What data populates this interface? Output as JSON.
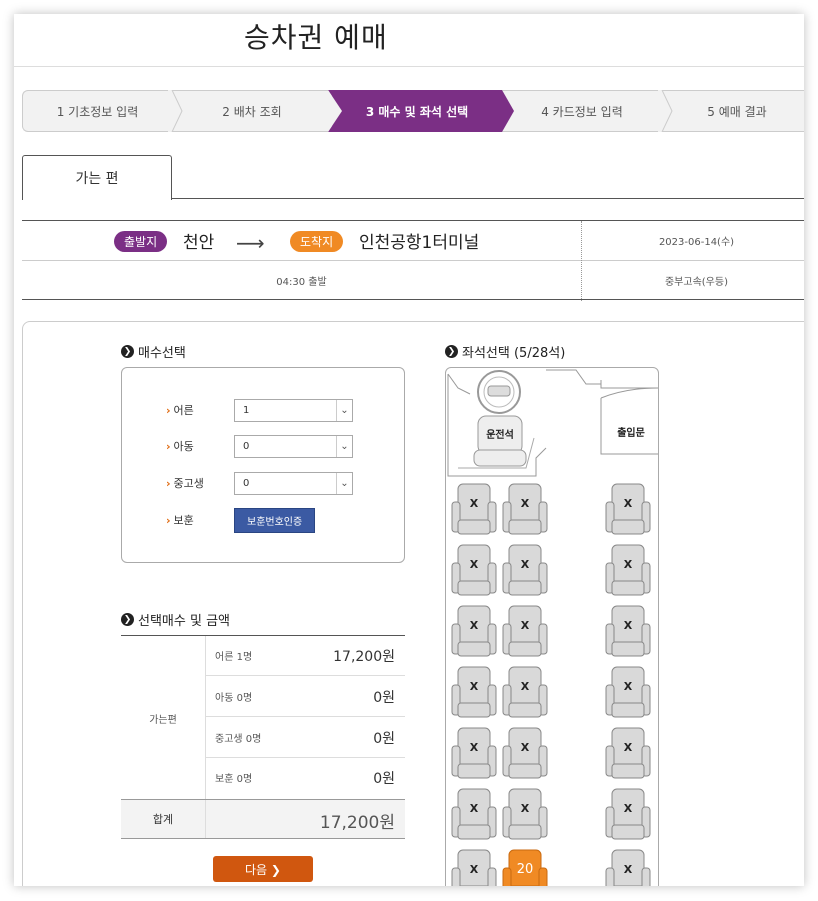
{
  "page": {
    "title": "승차권 예매"
  },
  "steps": [
    {
      "label": "1 기초정보 입력",
      "active": false
    },
    {
      "label": "2 배차 조회",
      "active": false
    },
    {
      "label": "3 매수 및 좌석 선택",
      "active": true
    },
    {
      "label": "4 카드정보 입력",
      "active": false
    },
    {
      "label": "5 예매 결과",
      "active": false
    }
  ],
  "tab": {
    "label": "가는 편"
  },
  "route": {
    "departure_badge": "출발지",
    "departure_city": "천안",
    "arrow": "⟶",
    "arrival_badge": "도착지",
    "arrival_city": "인천공항1터미널",
    "date": "2023-06-14(수)",
    "time": "04:30 출발",
    "company": "중부고속(우등)"
  },
  "quantity": {
    "title": "매수선택",
    "rows": [
      {
        "label": "어른",
        "value": "1"
      },
      {
        "label": "아동",
        "value": "0"
      },
      {
        "label": "중고생",
        "value": "0"
      }
    ],
    "veteran_label": "보훈",
    "veteran_button": "보훈번호인증"
  },
  "summary": {
    "title": "선택매수 및 금액",
    "side_label": "가는편",
    "rows": [
      {
        "label": "어른 1명",
        "value": "17,200원"
      },
      {
        "label": "아동 0명",
        "value": "0원"
      },
      {
        "label": "중고생 0명",
        "value": "0원"
      },
      {
        "label": "보훈 0명",
        "value": "0원"
      }
    ],
    "total_label": "합계",
    "total_value": "17,200원"
  },
  "next_button": "다음 ❯",
  "seats": {
    "title": "좌석선택 (5/28석)",
    "driver_label": "운전석",
    "door_label": "출입문",
    "taken_mark": "X",
    "available_seat": "20",
    "colors": {
      "available": "#f08a24",
      "taken": "#d9d9d9",
      "accent": "#7b2f85",
      "next": "#d0570f"
    }
  }
}
